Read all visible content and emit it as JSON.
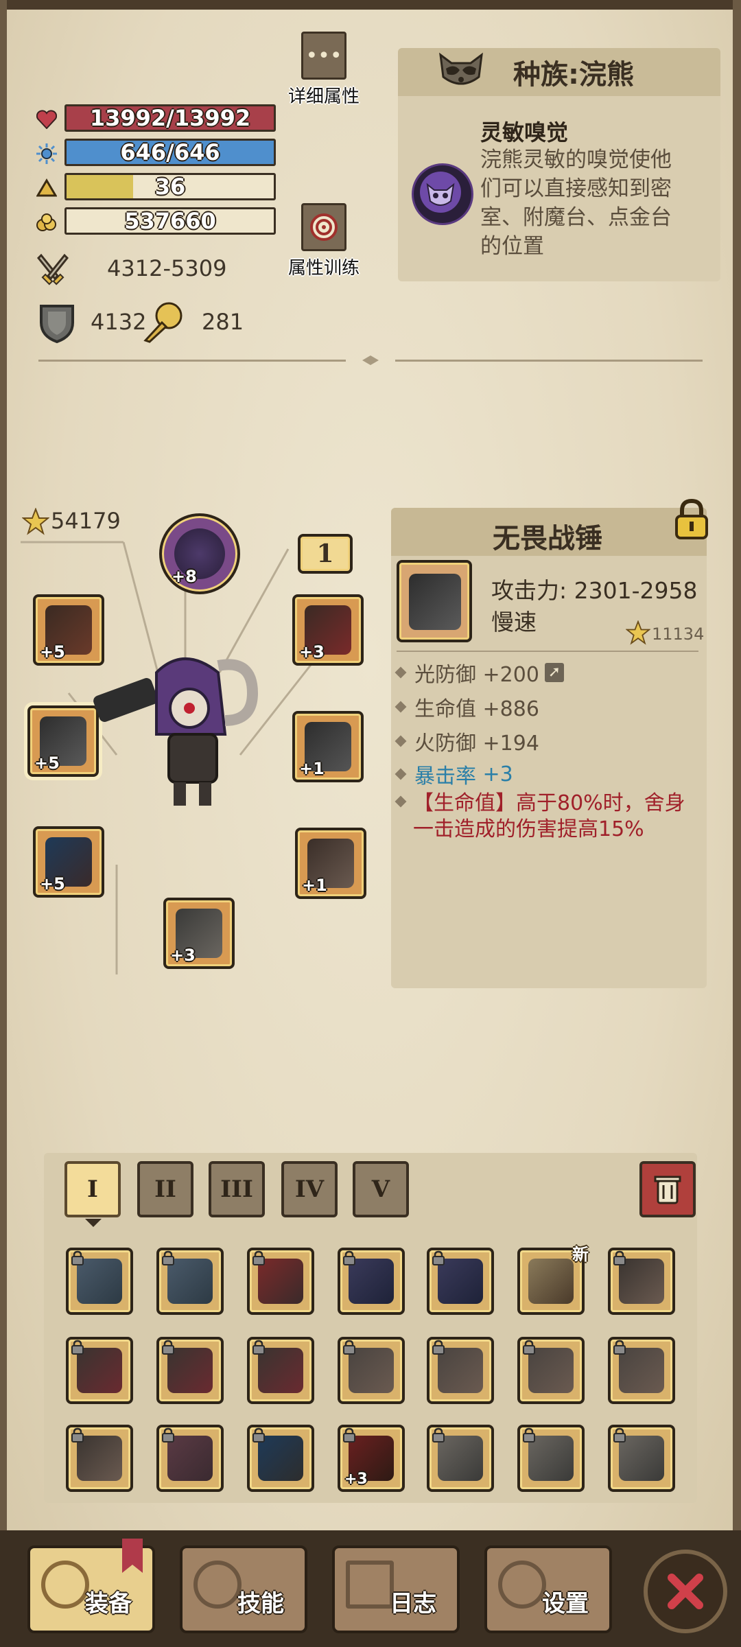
{
  "stats": {
    "hp": "13992/13992",
    "mp": "646/646",
    "level": "36",
    "gold": "537660",
    "attack": "4312-5309",
    "defense": "4132",
    "luck": "281"
  },
  "buttons": {
    "detail": "详细属性",
    "training": "属性训练"
  },
  "race": {
    "title": "种族:浣熊",
    "skill_name": "灵敏嗅觉",
    "skill_desc": "浣熊灵敏的嗅觉使他们可以直接感知到密室、附魔台、点金台的位置"
  },
  "equipment": {
    "score": "54179",
    "slot_count": "1",
    "slots": {
      "helmet": "+8",
      "shoulder": "+5",
      "weapon": "+5",
      "gloves": "+5",
      "boots": "+3",
      "cloak": "+3",
      "armor": "+1",
      "pants": "+1"
    }
  },
  "item_detail": {
    "name": "无畏战锤",
    "attack_label": "攻击力:",
    "attack_value": "2301-2958",
    "speed": "慢速",
    "score": "11134",
    "attributes": [
      "光防御 +200",
      "生命值 +886",
      "火防御 +194"
    ],
    "crit_label": "暴击率",
    "crit_value": "+3",
    "special": "【生命值】高于80%时，舍身一击造成的伤害提高15%"
  },
  "inventory": {
    "tabs": [
      "I",
      "II",
      "III",
      "IV",
      "V"
    ],
    "badge_plus": "+3",
    "new_label": "新"
  },
  "nav": {
    "equip": "装备",
    "skills": "技能",
    "log": "日志",
    "settings": "设置"
  },
  "colors": {
    "hp": "#a8404a",
    "mp": "#4f8fcd",
    "xp": "#d9c35a",
    "special_text": "#a0202a",
    "crit_text": "#2a7fa8"
  }
}
